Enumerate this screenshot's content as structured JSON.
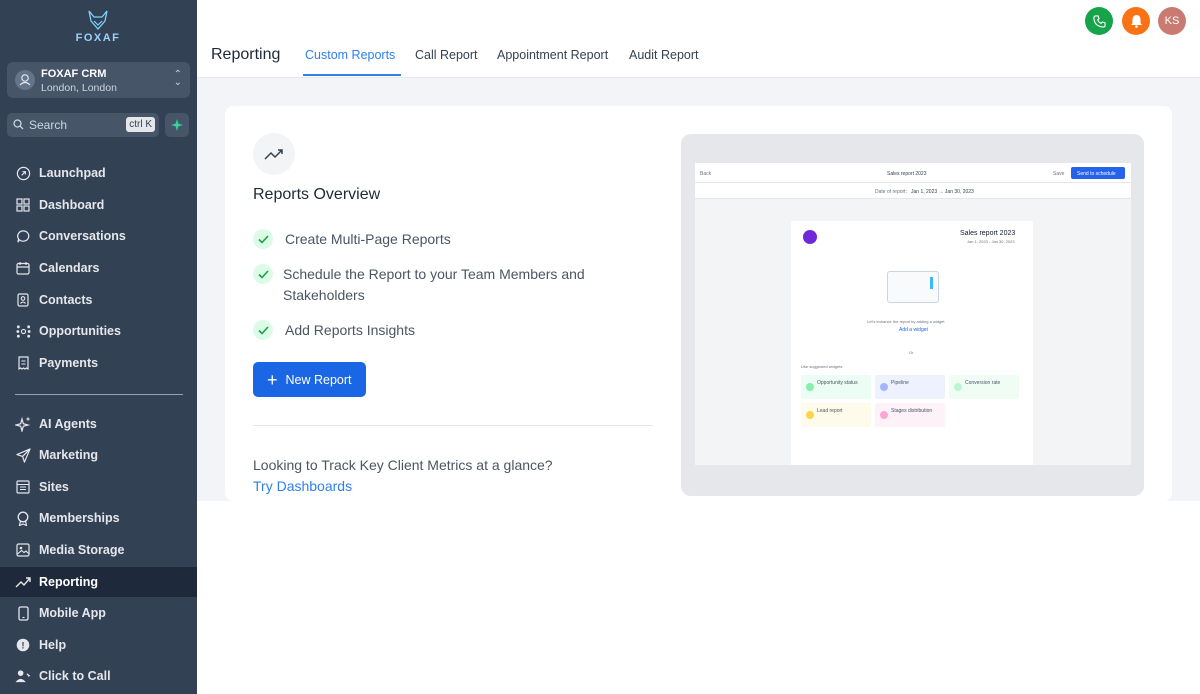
{
  "brand": {
    "name": "FOXAF"
  },
  "account": {
    "name": "FOXAF CRM",
    "location": "London, London"
  },
  "search": {
    "placeholder": "Search",
    "shortcut": "ctrl K"
  },
  "nav": {
    "items": [
      {
        "label": "Launchpad",
        "icon": "rocket-icon"
      },
      {
        "label": "Dashboard",
        "icon": "grid-icon"
      },
      {
        "label": "Conversations",
        "icon": "chat-bubble-icon"
      },
      {
        "label": "Calendars",
        "icon": "calendar-icon"
      },
      {
        "label": "Contacts",
        "icon": "contacts-icon"
      },
      {
        "label": "Opportunities",
        "icon": "opportunities-icon"
      },
      {
        "label": "Payments",
        "icon": "receipt-icon"
      }
    ],
    "secondary": [
      {
        "label": "AI Agents",
        "icon": "sparkles-icon"
      },
      {
        "label": "Marketing",
        "icon": "send-icon"
      },
      {
        "label": "Sites",
        "icon": "sites-icon"
      },
      {
        "label": "Memberships",
        "icon": "award-icon"
      },
      {
        "label": "Media Storage",
        "icon": "image-icon"
      },
      {
        "label": "Reporting",
        "icon": "trend-icon",
        "active": true
      },
      {
        "label": "Mobile App",
        "icon": "mobile-icon"
      },
      {
        "label": "Help",
        "icon": "help-icon"
      },
      {
        "label": "Click to Call",
        "icon": "user-phone-icon"
      }
    ]
  },
  "header": {
    "title": "Reporting",
    "tabs": [
      "Custom Reports",
      "Call Report",
      "Appointment Report",
      "Audit Report"
    ],
    "active_tab": "Custom Reports",
    "user_initials": "KS"
  },
  "overview": {
    "title": "Reports Overview",
    "features": [
      "Create Multi-Page Reports",
      "Schedule the Report to your Team Members and",
      "Stakeholders",
      "Add Reports Insights"
    ],
    "new_button": "New Report",
    "looking_text": "Looking to Track Key Client Metrics at a glance?",
    "link_text": "Try Dashboards"
  },
  "preview": {
    "back": "Back",
    "title": "Sales report 2023",
    "save": "Save",
    "send": "Send to schedule",
    "date_label": "Date of report:",
    "date_range": "Jan 1, 2023 → Jan 30, 2023",
    "page_title": "Sales report 2023",
    "page_dates": "Jan 1, 2023 - Jan 30, 2023",
    "hint": "Let's enhance the report by adding a widget",
    "add_widget": "Add a widget",
    "or": "Or",
    "suggested": "Use suggested widgets",
    "widgets": [
      "Opportunity status",
      "Pipeline",
      "Conversion rate",
      "Lead report",
      "Stages distribution"
    ]
  },
  "colors": {
    "sidebar": "#334155",
    "accent": "#2f80ed",
    "button": "#1a66e5",
    "phone": "#16a34a",
    "bell": "#f97316",
    "avatar": "#c97b72"
  }
}
